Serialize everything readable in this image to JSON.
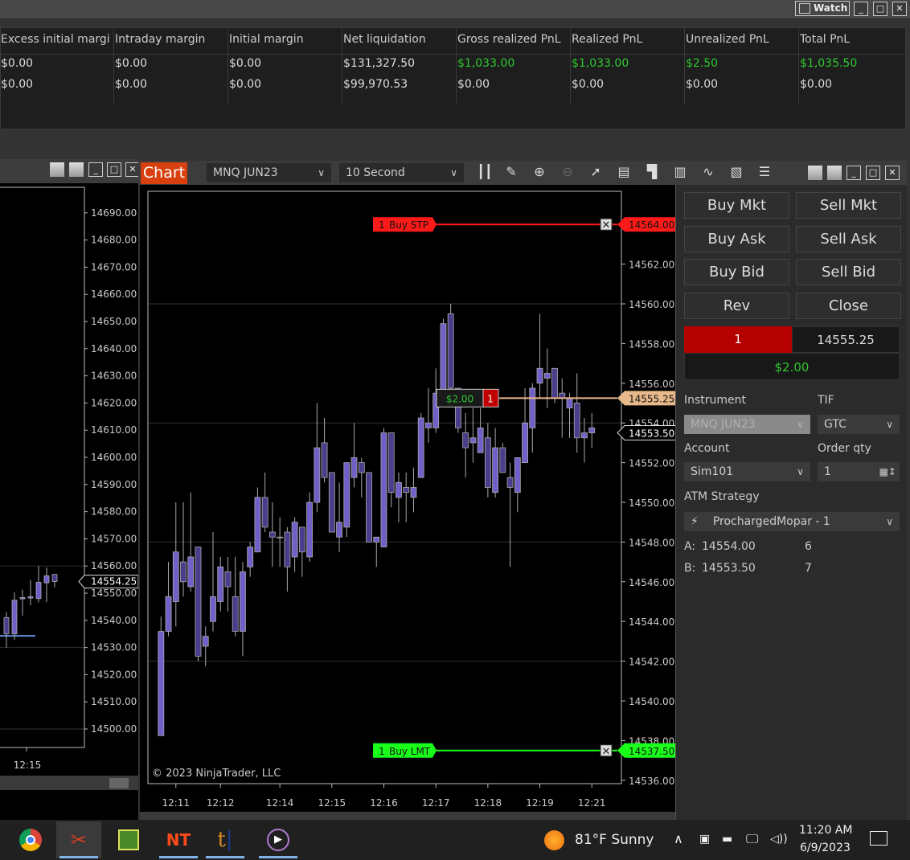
{
  "top_window": {
    "watch_label": "Watch"
  },
  "accounts": {
    "columns": [
      "Excess initial margi",
      "Intraday margin",
      "Initial margin",
      "Net liquidation",
      "Gross realized PnL",
      "Realized PnL",
      "Unrealized PnL",
      "Total PnL"
    ],
    "rows": [
      [
        "$0.00",
        "$0.00",
        "$0.00",
        "$131,327.50",
        "$1,033.00",
        "$1,033.00",
        "$2.50",
        "$1,035.50"
      ],
      [
        "$0.00",
        "$0.00",
        "$0.00",
        "$99,970.53",
        "$0.00",
        "$0.00",
        "$0.00",
        "$0.00"
      ]
    ],
    "positive_color": "#2ec82e"
  },
  "left_chart": {
    "y_ticks": [
      "14690.00",
      "14680.00",
      "14670.00",
      "14660.00",
      "14650.00",
      "14640.00",
      "14630.00",
      "14620.00",
      "14610.00",
      "14600.00",
      "14590.00",
      "14580.00",
      "14570.00",
      "14560.00",
      "14550.00",
      "14540.00",
      "14530.00",
      "14520.00",
      "14510.00",
      "14500.00"
    ],
    "last_price": "14554.25",
    "time_label": "12:15",
    "candles": [
      [
        14541,
        14543,
        14530,
        14535
      ],
      [
        14535,
        14550.3,
        14532.8,
        14547.4
      ],
      [
        14547.9,
        14551.3,
        14541.7,
        14548.4
      ],
      [
        14548.2,
        14554.8,
        14545.6,
        14548.7
      ],
      [
        14548,
        14560,
        14546.6,
        14554
      ],
      [
        14553.8,
        14559.4,
        14546.7,
        14556.4
      ],
      [
        14556.9,
        14556.9,
        14552.1,
        14554.3
      ]
    ],
    "line_price": 14534.3
  },
  "chart": {
    "title": "Chart",
    "instrument": "MNQ JUN23",
    "interval": "10 Second",
    "copyright": "© 2023 NinjaTrader, LLC",
    "y_ticks": [
      "14564.00",
      "14562.00",
      "14560.00",
      "14558.00",
      "14556.00",
      "14554.00",
      "14552.00",
      "14550.00",
      "14548.00",
      "14546.00",
      "14544.00",
      "14542.00",
      "14540.00",
      "14538.00",
      "14536.00"
    ],
    "x_ticks": [
      {
        "label": "12:11",
        "bar": 2
      },
      {
        "label": "12:12",
        "bar": 8
      },
      {
        "label": "12:14",
        "bar": 16
      },
      {
        "label": "12:15",
        "bar": 23
      },
      {
        "label": "12:16",
        "bar": 30
      },
      {
        "label": "12:17",
        "bar": 37
      },
      {
        "label": "12:18",
        "bar": 44
      },
      {
        "label": "12:19",
        "bar": 51
      },
      {
        "label": "12:21",
        "bar": 58
      }
    ],
    "candles_ohlc": [
      [
        14538.25,
        14544.25,
        14538.25,
        14543.5
      ],
      [
        14543.5,
        14547,
        14543.25,
        14545.25
      ],
      [
        14545,
        14550,
        14543.75,
        14547.5
      ],
      [
        14547,
        14550,
        14545.25,
        14546
      ],
      [
        14545.75,
        14550.5,
        14545.5,
        14547.25
      ],
      [
        14547.75,
        14547.75,
        14542,
        14542.25
      ],
      [
        14542.75,
        14543.75,
        14541.75,
        14543.25
      ],
      [
        14544,
        14548.5,
        14543.5,
        14545.25
      ],
      [
        14545,
        14547.25,
        14544.5,
        14546.75
      ],
      [
        14546.5,
        14547.25,
        14544.5,
        14545.75
      ],
      [
        14545.25,
        14547.25,
        14543.25,
        14543.5
      ],
      [
        14543.5,
        14547,
        14542.25,
        14546.5
      ],
      [
        14546.75,
        14548,
        14546.25,
        14547.75
      ],
      [
        14547.5,
        14550.75,
        14547.5,
        14550.25
      ],
      [
        14550.25,
        14551.5,
        14548.5,
        14548.75
      ],
      [
        14548.5,
        14550,
        14546.75,
        14548.25
      ],
      [
        14548.25,
        14549.25,
        14546.75,
        14548.25
      ],
      [
        14548.5,
        14548.75,
        14545.5,
        14546.75
      ],
      [
        14547.25,
        14549.25,
        14546.5,
        14549
      ],
      [
        14548.75,
        14548.75,
        14546.25,
        14547.5
      ],
      [
        14547.25,
        14550.5,
        14547,
        14550
      ],
      [
        14550,
        14555,
        14549.5,
        14552.75
      ],
      [
        14553,
        14554.25,
        14551,
        14551.25
      ],
      [
        14551.5,
        14551.5,
        14548.5,
        14548.5
      ],
      [
        14548.25,
        14551,
        14547.5,
        14549
      ],
      [
        14548.75,
        14552,
        14548.25,
        14552
      ],
      [
        14551.25,
        14554,
        14550.75,
        14552.25
      ],
      [
        14552,
        14552.25,
        14550.25,
        14551.5
      ],
      [
        14551.5,
        14551.5,
        14548,
        14548
      ],
      [
        14548,
        14548.25,
        14546.75,
        14548.25
      ],
      [
        14547.75,
        14553.75,
        14547.75,
        14553.5
      ],
      [
        14553.5,
        14553.5,
        14549.75,
        14550.5
      ],
      [
        14550.25,
        14551.5,
        14549,
        14551
      ],
      [
        14550.75,
        14551.5,
        14549,
        14550.5
      ],
      [
        14550.25,
        14551.75,
        14549.5,
        14550.75
      ],
      [
        14551.25,
        14554.5,
        14551.25,
        14554.25
      ],
      [
        14553.75,
        14555.75,
        14553,
        14554
      ],
      [
        14553.75,
        14556.75,
        14553.5,
        14555.5
      ],
      [
        14555.5,
        14559.25,
        14555,
        14559
      ],
      [
        14559.5,
        14560,
        14555.25,
        14555.75
      ],
      [
        14555.75,
        14555.75,
        14553.5,
        14553.75
      ],
      [
        14553.5,
        14554.5,
        14551.25,
        14552.75
      ],
      [
        14553,
        14554.75,
        14552,
        14553.25
      ],
      [
        14552.5,
        14554.75,
        14552.5,
        14553.75
      ],
      [
        14553.25,
        14554,
        14550.25,
        14550.75
      ],
      [
        14550.5,
        14553.75,
        14550.25,
        14552.75
      ],
      [
        14552.75,
        14553,
        14551.5,
        14551.5
      ],
      [
        14551.25,
        14552,
        14546.75,
        14550.75
      ],
      [
        14550.5,
        14552.25,
        14549.5,
        14552.25
      ],
      [
        14552,
        14555.75,
        14552,
        14554
      ],
      [
        14553.75,
        14556,
        14552.5,
        14555.75
      ],
      [
        14556,
        14559.5,
        14555.25,
        14556.75
      ],
      [
        14556.25,
        14557.75,
        14554.75,
        14556.5
      ],
      [
        14556.75,
        14556.75,
        14555,
        14555.25
      ],
      [
        14555.5,
        14556.25,
        14553.25,
        14555.25
      ],
      [
        14554.75,
        14555.5,
        14553.25,
        14555.25
      ],
      [
        14555,
        14556.5,
        14552.5,
        14553.25
      ],
      [
        14553.25,
        14554.25,
        14552,
        14553.5
      ],
      [
        14553.5,
        14554.5,
        14552.75,
        14553.75
      ]
    ],
    "up_color": "#7060c8",
    "down_color": "#4a3e8c",
    "buy_stop": {
      "qty": "1",
      "label": "Buy STP",
      "price": "14564.00",
      "color": "#ff1a1a"
    },
    "buy_limit": {
      "qty": "1",
      "label": "Buy LMT",
      "price": "14537.50",
      "color": "#1aff1a"
    },
    "position": {
      "pnl": "$2.00",
      "qty": "1",
      "price": "14555.25",
      "color": "#e8b98a"
    },
    "last_price": "14553.50"
  },
  "trader": {
    "buttons": [
      "Buy Mkt",
      "Sell Mkt",
      "Buy Ask",
      "Sell Ask",
      "Buy Bid",
      "Sell Bid",
      "Rev",
      "Close"
    ],
    "position_qty": "1",
    "avg_price": "14555.25",
    "unrealized": "$2.00",
    "instrument_label": "Instrument",
    "instrument": "MNQ JUN23",
    "tif_label": "TIF",
    "tif": "GTC",
    "account_label": "Account",
    "account": "Sim101",
    "qty_label": "Order qty",
    "qty": "1",
    "atm_label": "ATM Strategy",
    "atm": "ProchargedMopar - 1",
    "ask_label": "A:",
    "ask": "14554.00",
    "ask_size": "6",
    "bid_label": "B:",
    "bid": "14553.50",
    "bid_size": "7"
  },
  "taskbar": {
    "weather": "81°F  Sunny",
    "time": "11:20 AM",
    "date": "6/9/2023"
  }
}
